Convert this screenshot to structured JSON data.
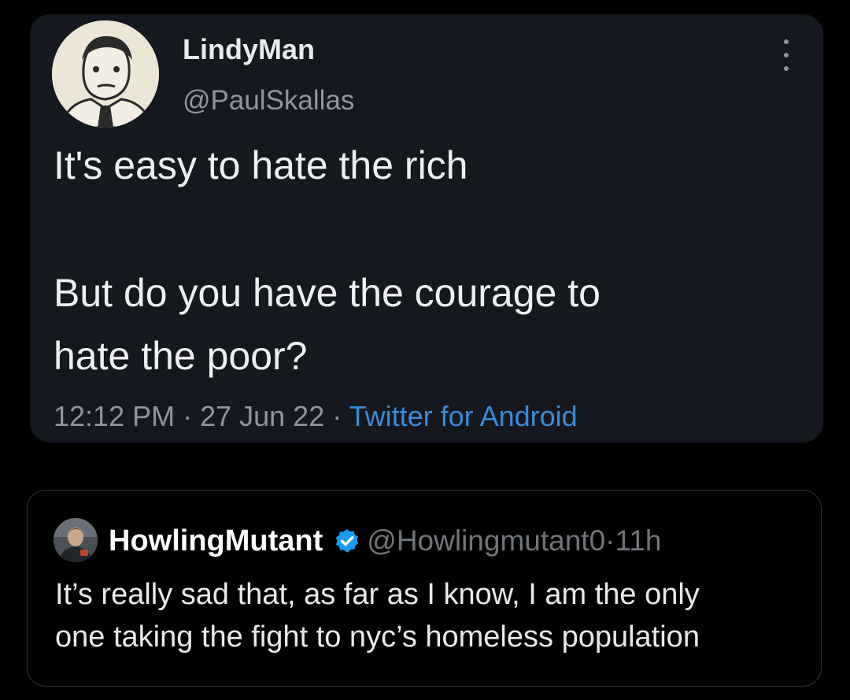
{
  "tweet": {
    "display_name": "LindyMan",
    "handle": "@PaulSkallas",
    "text_line1": "It's easy to hate the rich",
    "text_line2": "But do you have the courage to",
    "text_line3": "hate the poor?",
    "time": "12:12 PM",
    "date": "27 Jun 22",
    "separator": " · ",
    "source": "Twitter for Android",
    "avatar_icon": "cartoon-man-avatar",
    "more_icon": "more-vertical-icon"
  },
  "reply": {
    "display_name": "HowlingMutant",
    "verified_icon": "verified-badge-icon",
    "handle": "@Howlingmutant0",
    "separator": " · ",
    "age": "11h",
    "text_line1": "It’s really sad that, as far as I know, I am the only",
    "text_line2": "one taking the fight to nyc’s homeless population",
    "avatar_icon": "profile-photo-avatar"
  },
  "colors": {
    "background": "#000000",
    "card": "#15181f",
    "link": "#3b8ad8",
    "verified": "#1d9bf0",
    "muted": "#8f959c"
  }
}
